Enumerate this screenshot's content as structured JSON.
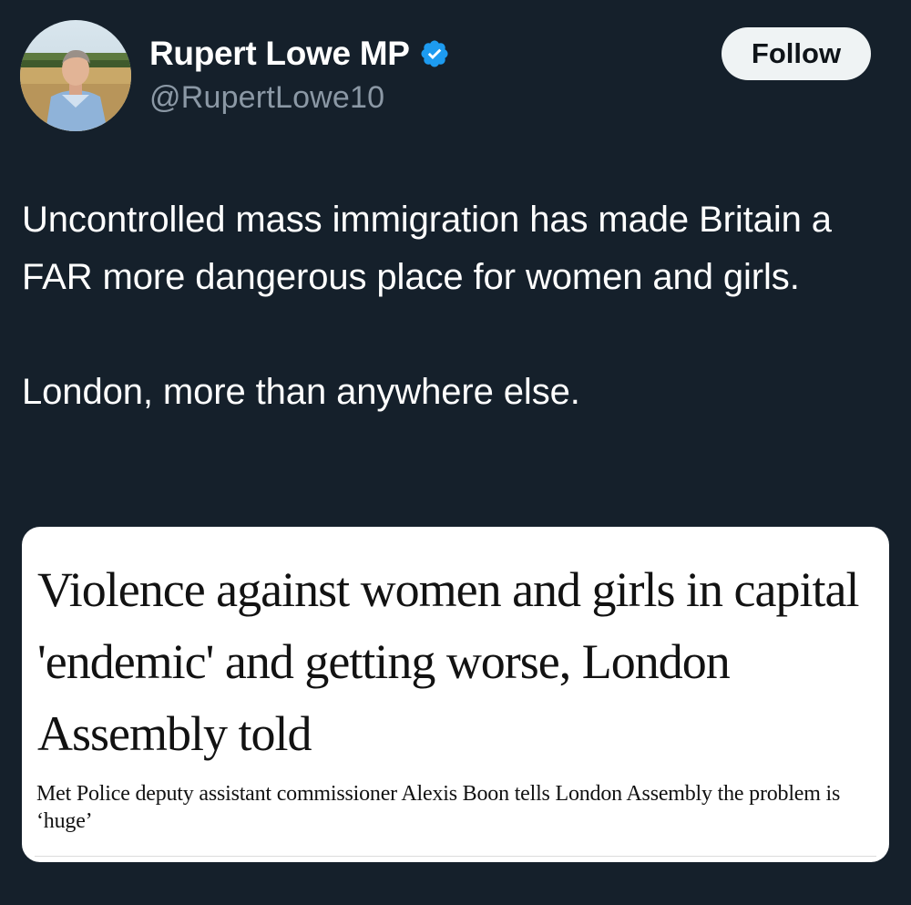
{
  "author": {
    "display_name": "Rupert Lowe MP",
    "handle": "@RupertLowe10",
    "verified_icon": "verified-badge-icon",
    "verified_color": "#1d9bf0"
  },
  "follow_button": {
    "label": "Follow"
  },
  "tweet": {
    "paragraphs": [
      "Uncontrolled mass immigration has made Britain a FAR more dangerous place for women and girls.",
      "London, more than anywhere else."
    ]
  },
  "media_card": {
    "headline": "Violence against women and girls in capital 'endemic' and getting worse, London Assembly told",
    "standfirst": "Met Police deputy assistant commissioner Alexis Boon tells London Assembly the problem is ‘huge’"
  },
  "colors": {
    "background": "#15202b",
    "primary_text": "#ffffff",
    "secondary_text": "#8b98a5",
    "button_bg": "#eff3f4",
    "button_text": "#0f1419",
    "card_bg": "#ffffff"
  }
}
